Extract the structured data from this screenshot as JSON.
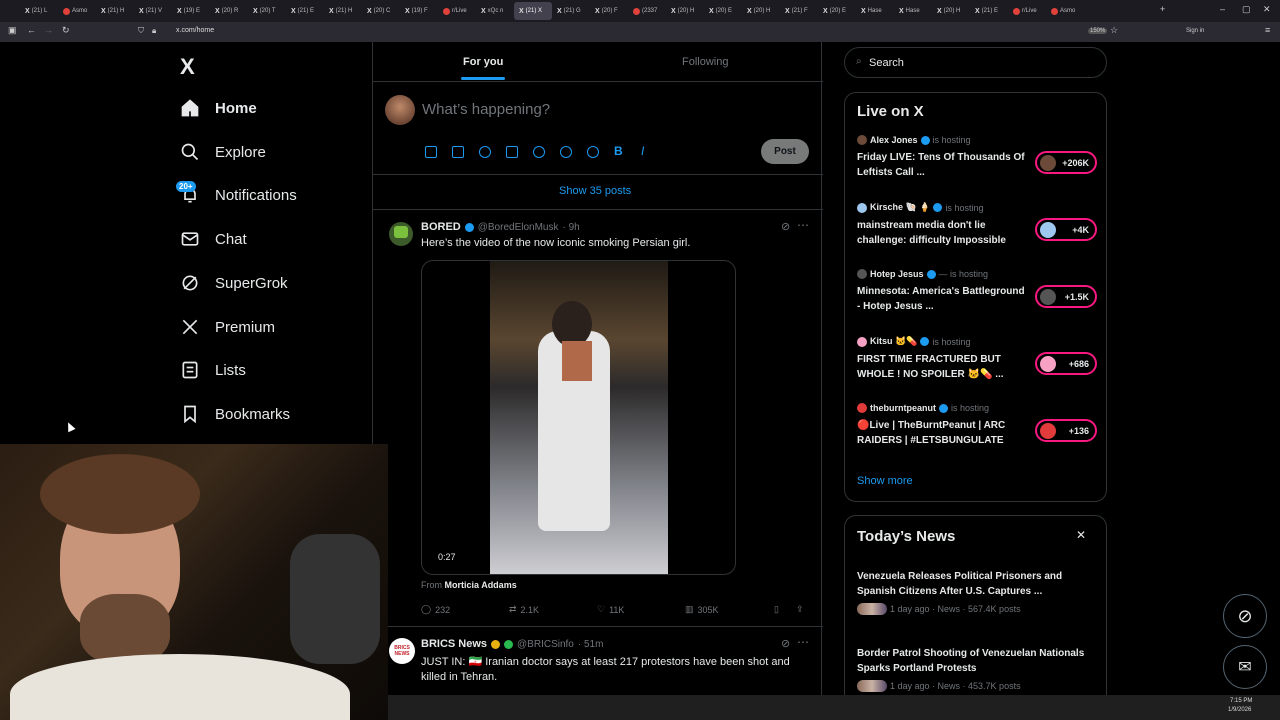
{
  "browser": {
    "tabs": [
      "(21) L",
      "Asmo",
      "(21) H",
      "(21) V",
      "(19) E",
      "(20) R",
      "(20) T",
      "(21) E",
      "(21) H",
      "(20) C",
      "(19) F",
      "r/Live",
      "xQc n",
      "(21) X",
      "(21) G",
      "(20) F",
      "(2337",
      "(20) H",
      "(20) E",
      "(20) H",
      "(21) F",
      "(20) E",
      "Hase",
      "Hase",
      "(20) H",
      "(21) E",
      "r/Live",
      "Asmo"
    ],
    "active_tab_index": 13,
    "url": "x.com/home",
    "zoom": "150%",
    "sign_in": "Sign in"
  },
  "nav": {
    "logo": "X",
    "items": [
      {
        "label": "Home",
        "icon": "home-icon"
      },
      {
        "label": "Explore",
        "icon": "search-icon"
      },
      {
        "label": "Notifications",
        "icon": "bell-icon"
      },
      {
        "label": "Chat",
        "icon": "mail-icon"
      },
      {
        "label": "SuperGrok",
        "icon": "grok-icon"
      },
      {
        "label": "Premium",
        "icon": "x-icon"
      },
      {
        "label": "Lists",
        "icon": "list-icon"
      },
      {
        "label": "Bookmarks",
        "icon": "bookmark-icon"
      }
    ],
    "notif_badge": "20+"
  },
  "timeline": {
    "tab_for_you": "For you",
    "tab_following": "Following",
    "compose_placeholder": "What’s happening?",
    "post_button": "Post",
    "show_posts": "Show 35 posts",
    "posts": [
      {
        "name": "BORED",
        "handle": "@BoredElonMusk",
        "time": "· 9h",
        "text": "Here’s the video of the now iconic smoking Persian girl.",
        "video_duration": "0:27",
        "from_label": "From",
        "from_name": "Morticia Addams",
        "replies": "232",
        "reposts": "2.1K",
        "likes": "11K",
        "views": "305K"
      },
      {
        "name": "BRICS News",
        "handle": "@BRICSinfo",
        "time": "· 51m",
        "text": "JUST IN: 🇮🇷 Iranian doctor says at least 217 protestors have been shot and killed in Tehran.",
        "avatar_text": "BRICS NEWS"
      }
    ]
  },
  "right": {
    "search_placeholder": "Search",
    "live_title": "Live on X",
    "live": [
      {
        "host": "Alex Jones",
        "status": "is hosting",
        "title": "Friday LIVE: Tens Of Thousands Of Leftists Call ...",
        "count": "+206K",
        "av": "#6b4a3a"
      },
      {
        "host": "Kirsche 🐚 🍦",
        "status": "is hosting",
        "title": "mainstream media don't lie challenge: difficulty Impossible",
        "count": "+4K",
        "av": "#9ec7f0"
      },
      {
        "host": "Hotep Jesus",
        "status": "— is hosting",
        "title": "Minnesota: America's Battleground - Hotep Jesus ...",
        "count": "+1.5K",
        "av": "#555"
      },
      {
        "host": "Kitsu 🐱💊",
        "status": "is hosting",
        "title": "FIRST TIME FRACTURED BUT WHOLE ! NO SPOILER 🐱💊 ...",
        "count": "+686",
        "av": "#f7a1c4"
      },
      {
        "host": "theburntpeanut",
        "status": "is hosting",
        "title": "🔴Live | TheBurntPeanut | ARC RAIDERS | #LETSBUNGULATE",
        "count": "+136",
        "av": "#e23b3b"
      }
    ],
    "show_more": "Show more",
    "news_title": "Today’s News",
    "news": [
      {
        "title": "Venezuela Releases Political Prisoners and Spanish Citizens After U.S. Captures ...",
        "meta": "1 day ago · News · 567.4K posts"
      },
      {
        "title": "Border Patrol Shooting of Venezuelan Nationals Sparks Portland Protests",
        "meta": "1 day ago · News · 453.7K posts"
      }
    ]
  },
  "taskbar": {
    "time": "7:15 PM",
    "date": "1/9/2026"
  },
  "colors": {
    "accent": "#1d9bf0",
    "live": "#f91880",
    "bg": "#000000",
    "border": "#2f3336"
  }
}
